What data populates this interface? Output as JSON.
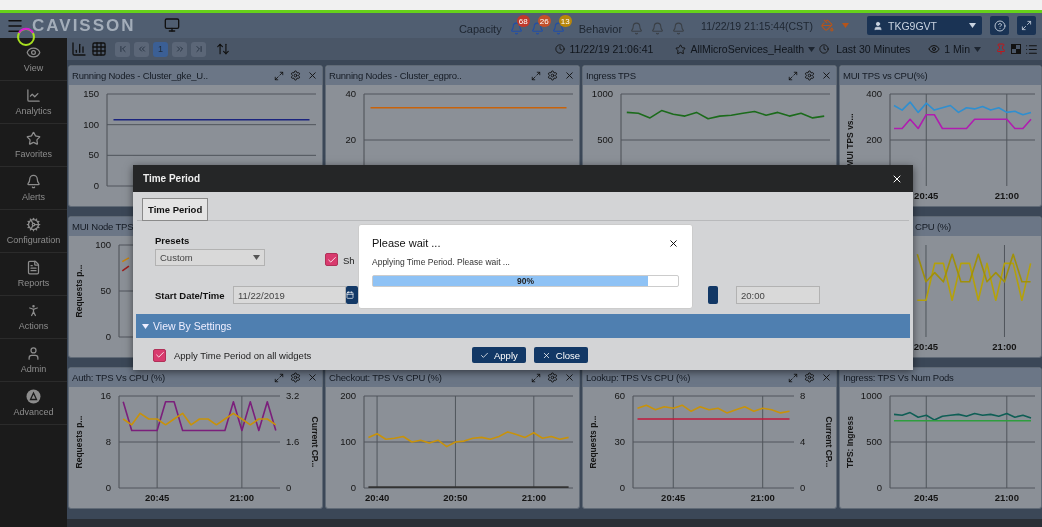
{
  "header": {
    "logo": "CAVISSON",
    "capacity": {
      "label": "Capacity",
      "alerts": [
        {
          "count": "68",
          "color": "#c0392b"
        },
        {
          "count": "26",
          "color": "#c2502a"
        },
        {
          "count": "13",
          "color": "#b8860b"
        }
      ]
    },
    "behavior": {
      "label": "Behavior"
    },
    "datetime": "11/22/19 21:15:44(CST)",
    "user": "TKG9GVT"
  },
  "sidebar": {
    "items": [
      {
        "label": "View"
      },
      {
        "label": "Analytics"
      },
      {
        "label": "Favorites"
      },
      {
        "label": "Alerts"
      },
      {
        "label": "Configuration"
      },
      {
        "label": "Reports"
      },
      {
        "label": "Actions"
      },
      {
        "label": "Admin"
      },
      {
        "label": "Advanced"
      }
    ]
  },
  "toolbar": {
    "page": {
      "label": "1",
      "selected": true
    },
    "time": "11/22/19 21:06:41",
    "dashboard": "AllMicroServices_Health",
    "range": "Last 30 Minutes",
    "interval": "1 Min"
  },
  "rows": [
    {
      "widgets": [
        {
          "title": "Running Nodes - Cluster_gke_U..",
          "chart_data": {
            "type": "line",
            "grid": true,
            "categories": [
              null,
              null,
              null,
              null,
              null,
              null,
              null,
              null,
              null,
              null,
              null,
              null,
              null,
              null,
              null,
              null
            ],
            "ylim": [
              0,
              150
            ],
            "yticks": [
              0,
              50,
              100,
              150
            ],
            "series": [
              {
                "color": "#1a237e",
                "values": [
                  108,
                  108,
                  108,
                  108,
                  108,
                  108,
                  108,
                  108,
                  108,
                  108,
                  108,
                  108,
                  108,
                  108,
                  108,
                  108
                ]
              }
            ]
          }
        },
        {
          "title": "Running Nodes - Cluster_egpro..",
          "chart_data": {
            "type": "line",
            "grid": true,
            "categories": [
              null,
              null,
              null,
              null,
              null,
              null,
              null,
              null,
              null,
              null,
              null,
              null,
              null,
              null,
              null,
              null
            ],
            "ylim": [
              0,
              40
            ],
            "yticks": [
              20,
              40
            ],
            "series": [
              {
                "color": "#c8620a",
                "values": [
                  34,
                  34,
                  34,
                  34,
                  34,
                  34,
                  34,
                  34,
                  34,
                  34,
                  34,
                  34,
                  34,
                  34,
                  34,
                  34
                ]
              }
            ]
          }
        },
        {
          "title": "Ingress TPS",
          "chart_data": {
            "type": "line",
            "grid": true,
            "categories": [
              null,
              null,
              null,
              null,
              null,
              null,
              null,
              null,
              null,
              null,
              null,
              null,
              null,
              null,
              null,
              null,
              null,
              null
            ],
            "ylim": [
              0,
              1000
            ],
            "yticks": [
              500,
              1000
            ],
            "series": [
              {
                "color": "#1b6b1b",
                "values": [
                  800,
                  790,
                  740,
                  820,
                  780,
                  760,
                  800,
                  730,
                  760,
                  770,
                  790,
                  810,
                  770,
                  800,
                  760,
                  790,
                  740,
                  760
                ]
              }
            ]
          }
        },
        {
          "title": "MUI TPS vs CPU(%)",
          "chart_data": {
            "type": "line",
            "grid": true,
            "categories": [
              null,
              null,
              null,
              null,
              "20:45",
              null,
              null,
              null,
              null,
              null,
              null,
              null,
              null,
              null,
              "21:00",
              null,
              null,
              null
            ],
            "ylabel": "MUI TPS vs...",
            "ylim": [
              0,
              400
            ],
            "yticks": [
              200,
              400
            ],
            "series": [
              {
                "color": "#2f8fd0",
                "values": [
                  350,
                  330,
                  365,
                  320,
                  360,
                  330,
                  340,
                  350,
                  320,
                  340,
                  335,
                  345,
                  330,
                  340,
                  320,
                  325,
                  310,
                  320
                ]
              },
              {
                "color": "#b01cb0",
                "values": [
                  250,
                  250,
                  290,
                  250,
                  310,
                  310,
                  250,
                  250,
                  250,
                  250,
                  290,
                  290,
                  290,
                  290,
                  290,
                  250,
                  250,
                  290
                ]
              }
            ]
          }
        }
      ]
    },
    {
      "widgets": [
        {
          "title": "MUI Node TPS",
          "chart_data": {
            "type": "line",
            "grid": true,
            "categories": [
              null,
              null,
              null,
              null,
              null,
              null,
              null,
              null,
              null,
              null,
              null,
              null,
              null,
              null,
              null,
              null,
              null,
              null,
              null,
              null,
              null,
              null,
              null,
              null,
              null,
              null,
              null,
              null,
              null,
              null
            ],
            "ylim": [
              0,
              100
            ],
            "ylabel": "Requests p...",
            "yticks": [
              0,
              50,
              100
            ],
            "series": [
              {
                "color": "#c8820a",
                "values": [
                  82,
                  86,
                  null,
                  null,
                  null,
                  null,
                  null,
                  null,
                  null,
                  null,
                  null,
                  null,
                  null,
                  null,
                  null,
                  null,
                  null,
                  null,
                  null,
                  null,
                  null,
                  null,
                  null,
                  null,
                  null,
                  null,
                  null,
                  null,
                  null,
                  null
                ]
              },
              {
                "color": "#9c1c1c",
                "values": [
                  72,
                  77,
                  null,
                  null,
                  null,
                  null,
                  null,
                  null,
                  null,
                  null,
                  null,
                  null,
                  null,
                  null,
                  null,
                  null,
                  null,
                  null,
                  null,
                  null,
                  null,
                  null,
                  null,
                  null,
                  null,
                  null,
                  null,
                  null,
                  null,
                  null
                ]
              }
            ]
          }
        },
        {
          "title": "CPU (%)",
          "time_labels": [
            "20:45",
            "21:00"
          ]
        }
      ]
    },
    {
      "widgets": [
        {
          "title": "Auth: TPS Vs CPU (%)",
          "chart_data": {
            "type": "line",
            "grid": true,
            "categories": [
              null,
              null,
              null,
              null,
              "20:45",
              null,
              null,
              null,
              null,
              null,
              null,
              null,
              null,
              null,
              "21:00",
              null,
              null,
              null,
              null
            ],
            "ylim": [
              0,
              16
            ],
            "ylabel": "Requests p...",
            "yticks": [
              0,
              8,
              16
            ],
            "y2lim": [
              0,
              3.2
            ],
            "y2label": "Current CP...",
            "y2ticks": [
              0,
              1.6,
              3.2
            ],
            "series": [
              {
                "color": "#7b1f7b",
                "values": [
                  15,
                  10,
                  10,
                  10,
                  10,
                  15,
                  15,
                  10,
                  10,
                  10,
                  10,
                  10,
                  10,
                  15,
                  10,
                  15,
                  10,
                  15,
                  10
                ]
              },
              {
                "color": "#c8920a",
                "values": [
                  12,
                  11,
                  13,
                  12,
                  12,
                  11,
                  12,
                  13,
                  11,
                  12,
                  12,
                  11,
                  12,
                  13,
                  12,
                  11,
                  12,
                  12,
                  11
                ]
              }
            ]
          }
        },
        {
          "title": "Checkout: TPS Vs CPU (%)",
          "chart_data": {
            "type": "line",
            "grid": true,
            "categories": [
              null,
              "20:40",
              null,
              null,
              null,
              null,
              null,
              null,
              null,
              null,
              "20:50",
              null,
              null,
              null,
              null,
              null,
              null,
              null,
              null,
              "21:00",
              null,
              null,
              null,
              null
            ],
            "ylim": [
              0,
              200
            ],
            "yticks": [
              0,
              100,
              200
            ],
            "series": [
              {
                "color": "#c8920a",
                "values": [
                  110,
                  118,
                  106,
                  108,
                  112,
                  100,
                  104,
                  98,
                  104,
                  90,
                  100,
                  102,
                  108,
                  110,
                  106,
                  112,
                  122,
                  116,
                  110,
                  120,
                  108,
                  112,
                  106,
                  110
                ]
              },
              {
                "color": "#333333",
                "values": [
                  2,
                  2,
                  2,
                  2,
                  2,
                  2,
                  2,
                  2,
                  2,
                  2,
                  2,
                  2,
                  2,
                  2,
                  2,
                  2,
                  2,
                  2,
                  2,
                  2,
                  2,
                  2,
                  2,
                  2
                ]
              }
            ]
          }
        },
        {
          "title": "Lookup: TPS Vs CPU (%)",
          "chart_data": {
            "type": "line",
            "grid": true,
            "categories": [
              null,
              null,
              null,
              null,
              "20:45",
              null,
              null,
              null,
              null,
              null,
              null,
              null,
              null,
              null,
              "21:00",
              null,
              null,
              null
            ],
            "ylim": [
              0,
              60
            ],
            "ylabel": "Requests p...",
            "yticks": [
              0,
              30,
              60
            ],
            "y2lim": [
              0,
              8
            ],
            "y2label": "Current CP...",
            "y2ticks": [
              0,
              4,
              8
            ],
            "series": [
              {
                "color": "#c8920a",
                "values": [
                  52,
                  54,
                  51,
                  53,
                  52,
                  54,
                  50,
                  53,
                  51,
                  52,
                  49,
                  51,
                  53,
                  50,
                  52,
                  51,
                  49,
                  50
                ]
              },
              {
                "color": "#c0183c",
                "values": [
                  45,
                  45,
                  45,
                  45,
                  45,
                  45,
                  45,
                  45,
                  45,
                  45,
                  45,
                  45,
                  45,
                  45,
                  45,
                  45,
                  45,
                  45
                ]
              }
            ]
          }
        },
        {
          "title": "Ingress: TPS Vs Num Pods",
          "chart_data": {
            "type": "line",
            "grid": true,
            "categories": [
              null,
              null,
              null,
              null,
              "20:45",
              null,
              null,
              null,
              null,
              null,
              null,
              null,
              null,
              null,
              "21:00",
              null,
              null,
              null
            ],
            "ylim": [
              0,
              1000
            ],
            "ylabel": "TPS: Ingress",
            "yticks": [
              0,
              500,
              1000
            ],
            "series": [
              {
                "color": "#0f5e55",
                "values": [
                  800,
                  790,
                  820,
                  770,
                  790,
                  740,
                  780,
                  790,
                  800,
                  780,
                  810,
                  790,
                  800,
                  780,
                  810,
                  770,
                  790,
                  760
                ]
              },
              {
                "color": "#2e9e3e",
                "values": [
                  730,
                  730,
                  730,
                  730,
                  730,
                  730,
                  730,
                  730,
                  730,
                  730,
                  730,
                  730,
                  730,
                  730,
                  730,
                  730,
                  730,
                  730
                ]
              }
            ]
          }
        }
      ]
    }
  ],
  "dialog": {
    "title": "Time Period",
    "tab": {
      "label": "Time Period",
      "selected": true
    },
    "presets_label": "Presets",
    "preset": "Custom",
    "option": {
      "label": "Sh",
      "checked": true
    },
    "start_label": "Start Date/Time",
    "start_date": "11/22/2019",
    "end_time": "20:00",
    "section": "View By Settings",
    "apply_all": {
      "label": "Apply Time Period on all widgets",
      "checked": true
    },
    "buttons": [
      {
        "label": "Apply",
        "kind": "apply"
      },
      {
        "label": "Close",
        "kind": "close"
      }
    ]
  },
  "wait": {
    "title": "Please wait ...",
    "message": "Applying Time Period. Please wait ...",
    "progress": {
      "level": 0.9,
      "reading": "90%"
    }
  }
}
